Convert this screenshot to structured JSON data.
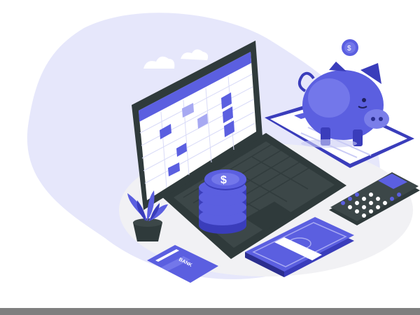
{
  "illustration": {
    "card_label": "BANK",
    "icons": [
      "cloud-icon",
      "piggy-bank-icon",
      "dollar-coin-icon",
      "laptop-icon",
      "spreadsheet-icon",
      "calculator-icon",
      "plant-icon",
      "credit-card-icon",
      "cash-bundle-icon",
      "clipboard-icon"
    ],
    "colors": {
      "accent": "#5b5fe0",
      "accent_dark": "#3a3dbb",
      "accent_light": "#a7a9f2",
      "blob": "#e6e7fb",
      "laptop": "#2f3a3b",
      "bar": "#7f7f7f"
    }
  }
}
